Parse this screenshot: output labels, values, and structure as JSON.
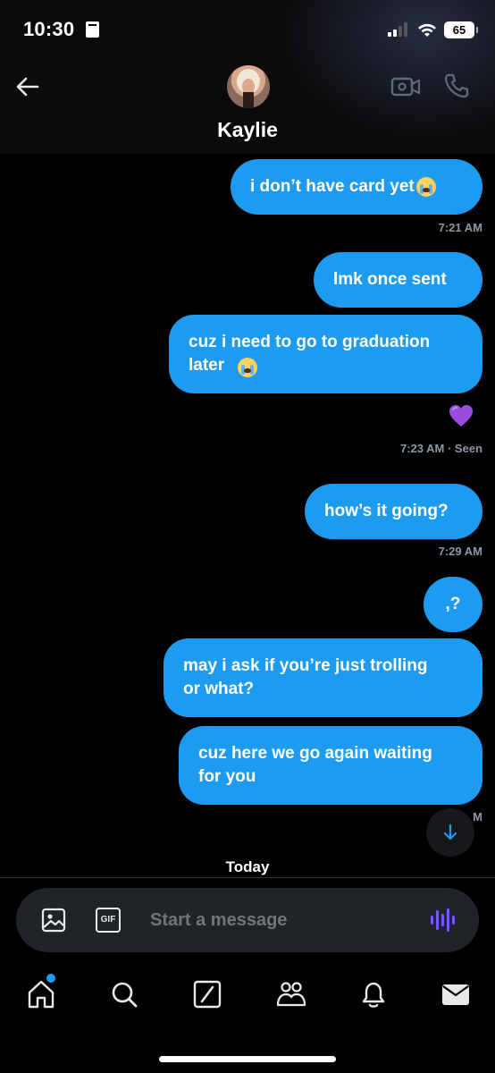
{
  "status_bar": {
    "time": "10:30",
    "battery": "65"
  },
  "header": {
    "contact_name": "Kaylie"
  },
  "messages": [
    {
      "text": "i don’t have card yet",
      "emoji": "sob"
    },
    {
      "time": "7:21 AM"
    },
    {
      "text": "lmk once sent"
    },
    {
      "text": "cuz i need to go to graduation\nlater",
      "emoji": "sob"
    },
    {
      "reaction": "purple-heart"
    },
    {
      "time": "7:23 AM · Seen"
    },
    {
      "text": "how’s it going?"
    },
    {
      "time": "7:29 AM"
    },
    {
      "text": ",?"
    },
    {
      "text": "may i ask if you’re just trolling\nor what?"
    },
    {
      "text": "cuz here we go again waiting\nfor you"
    },
    {
      "time": "M"
    }
  ],
  "day_divider": "Today",
  "composer": {
    "placeholder": "Start a message",
    "gif_label": "GIF"
  },
  "tabs": [
    "home-icon",
    "search-icon",
    "grok-icon",
    "communities-icon",
    "notifications-icon",
    "messages-icon"
  ],
  "colors": {
    "bubble": "#1d9bf0",
    "background": "#000000",
    "meta_text": "#8b98a5",
    "voice_accent": "#7856ff"
  }
}
